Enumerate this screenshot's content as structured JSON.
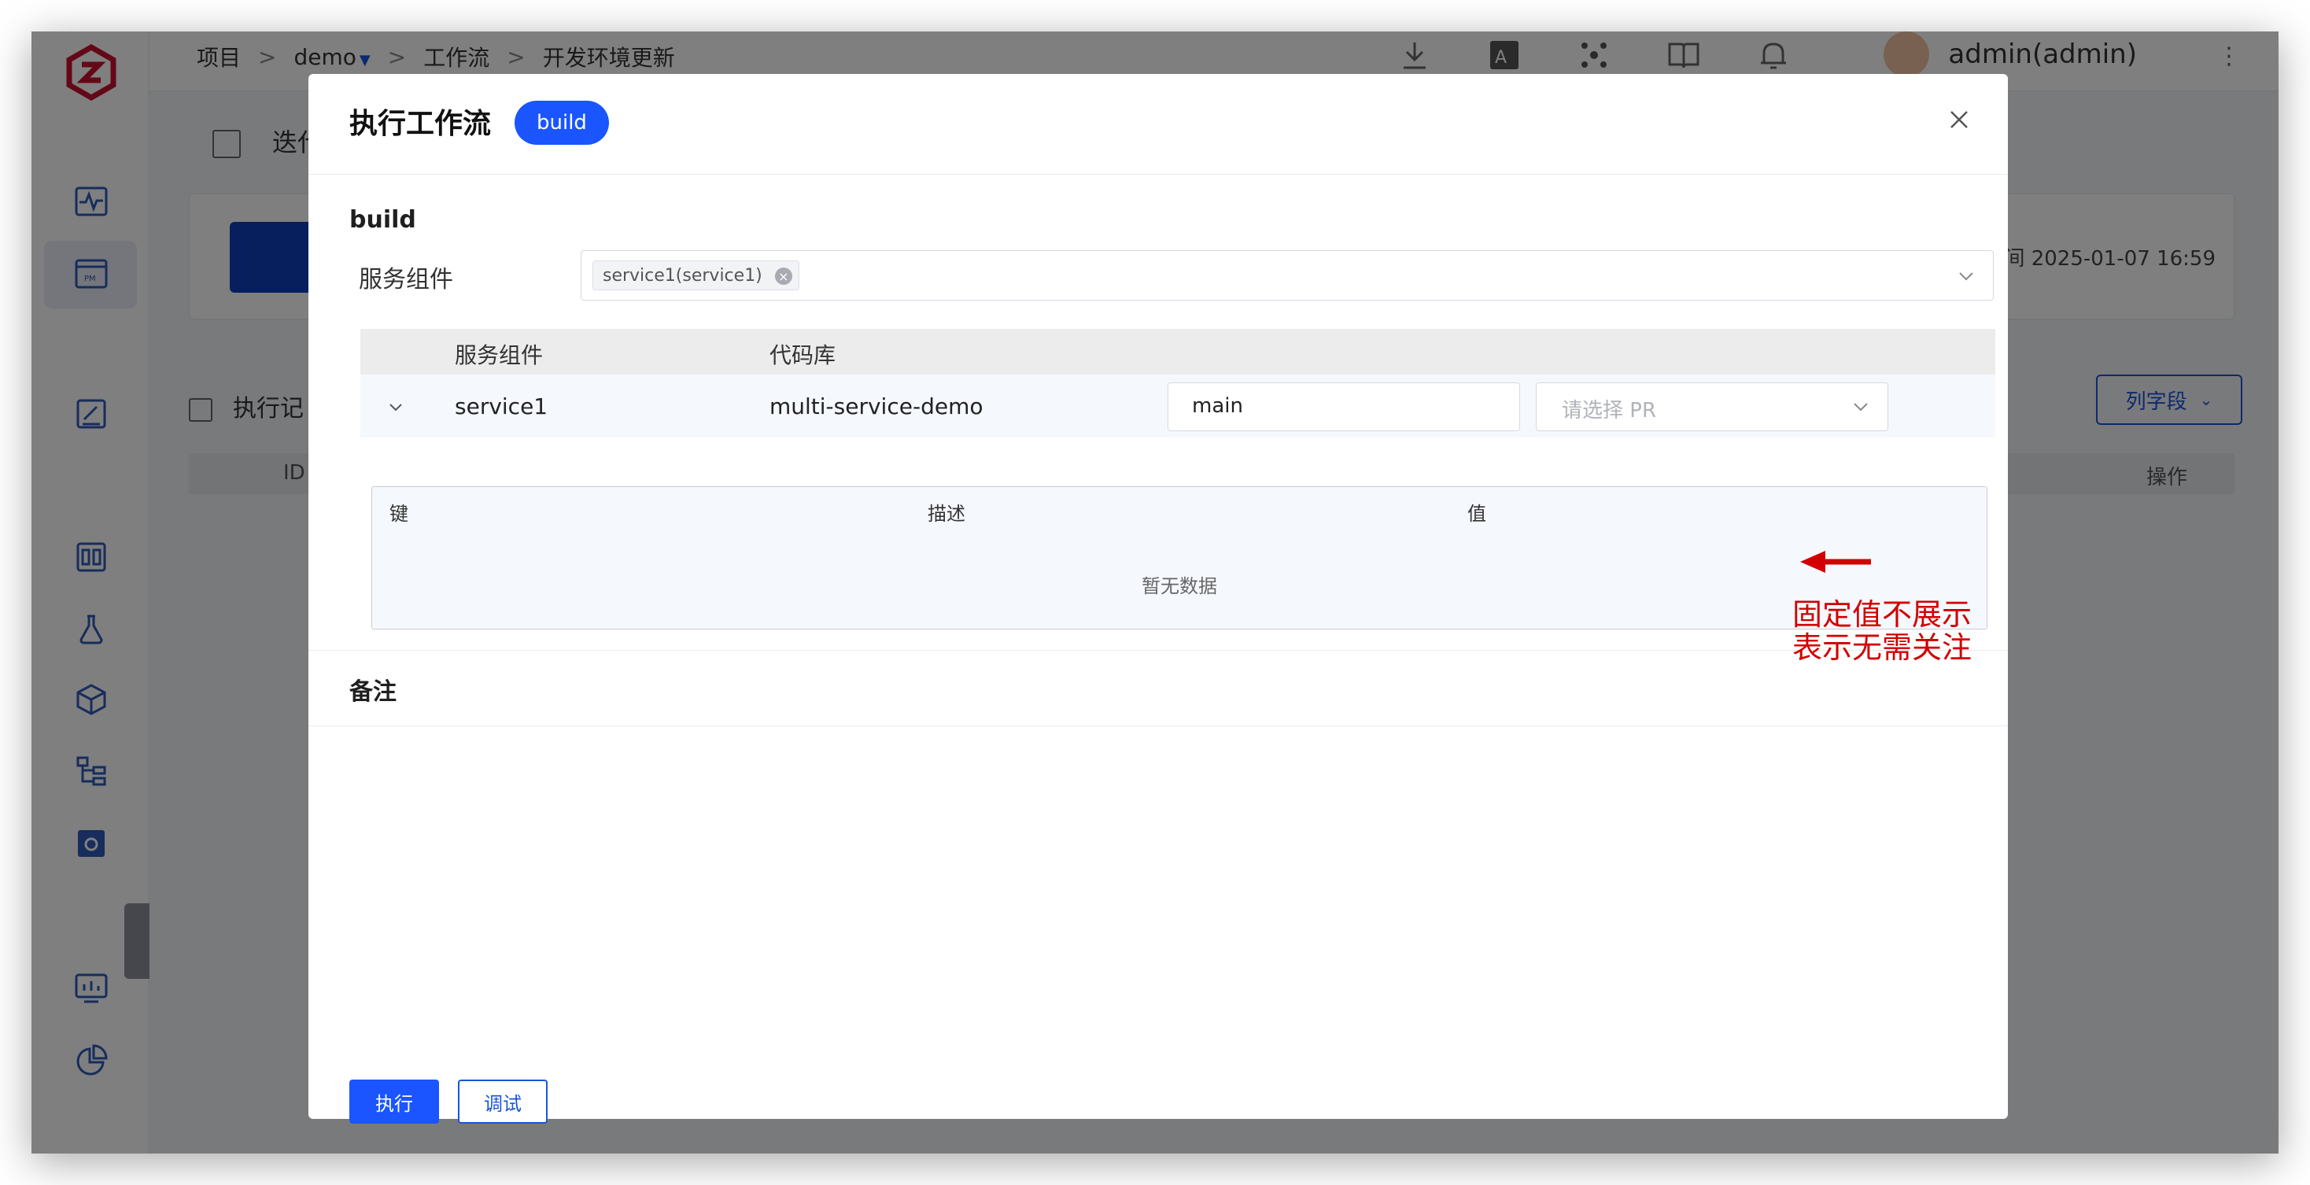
{
  "breadcrumb": {
    "project": "项目",
    "sep": ">",
    "project_name": "demo",
    "workflow": "工作流",
    "workflow_name": "开发环境更新"
  },
  "user": {
    "name": "admin(admin)"
  },
  "background": {
    "page_title": "迭代",
    "time_text": "间 2025-01-07 16:59",
    "section_title": "执行记",
    "column_button": "列字段",
    "table_id_col": "ID",
    "table_op_col": "操作"
  },
  "modal": {
    "title": "执行工作流",
    "badge": "build",
    "section_build": "build",
    "service_label": "服务组件",
    "selected_tag": "service1(service1)",
    "table": {
      "col_service": "服务组件",
      "col_repo": "代码库",
      "row": {
        "service": "service1",
        "repo": "multi-service-demo",
        "branch": "main",
        "pr_placeholder": "请选择 PR"
      }
    },
    "kv": {
      "col_key": "键",
      "col_desc": "描述",
      "col_value": "值",
      "empty": "暂无数据"
    },
    "section_notes": "备注",
    "run_button": "执行",
    "debug_button": "调试"
  },
  "annotation": {
    "line1": "固定值不展示",
    "line2": "表示无需关注",
    "color": "#d20000"
  },
  "colors": {
    "primary": "#1a55ff",
    "overlay": "rgba(0,0,0,0.5)"
  }
}
